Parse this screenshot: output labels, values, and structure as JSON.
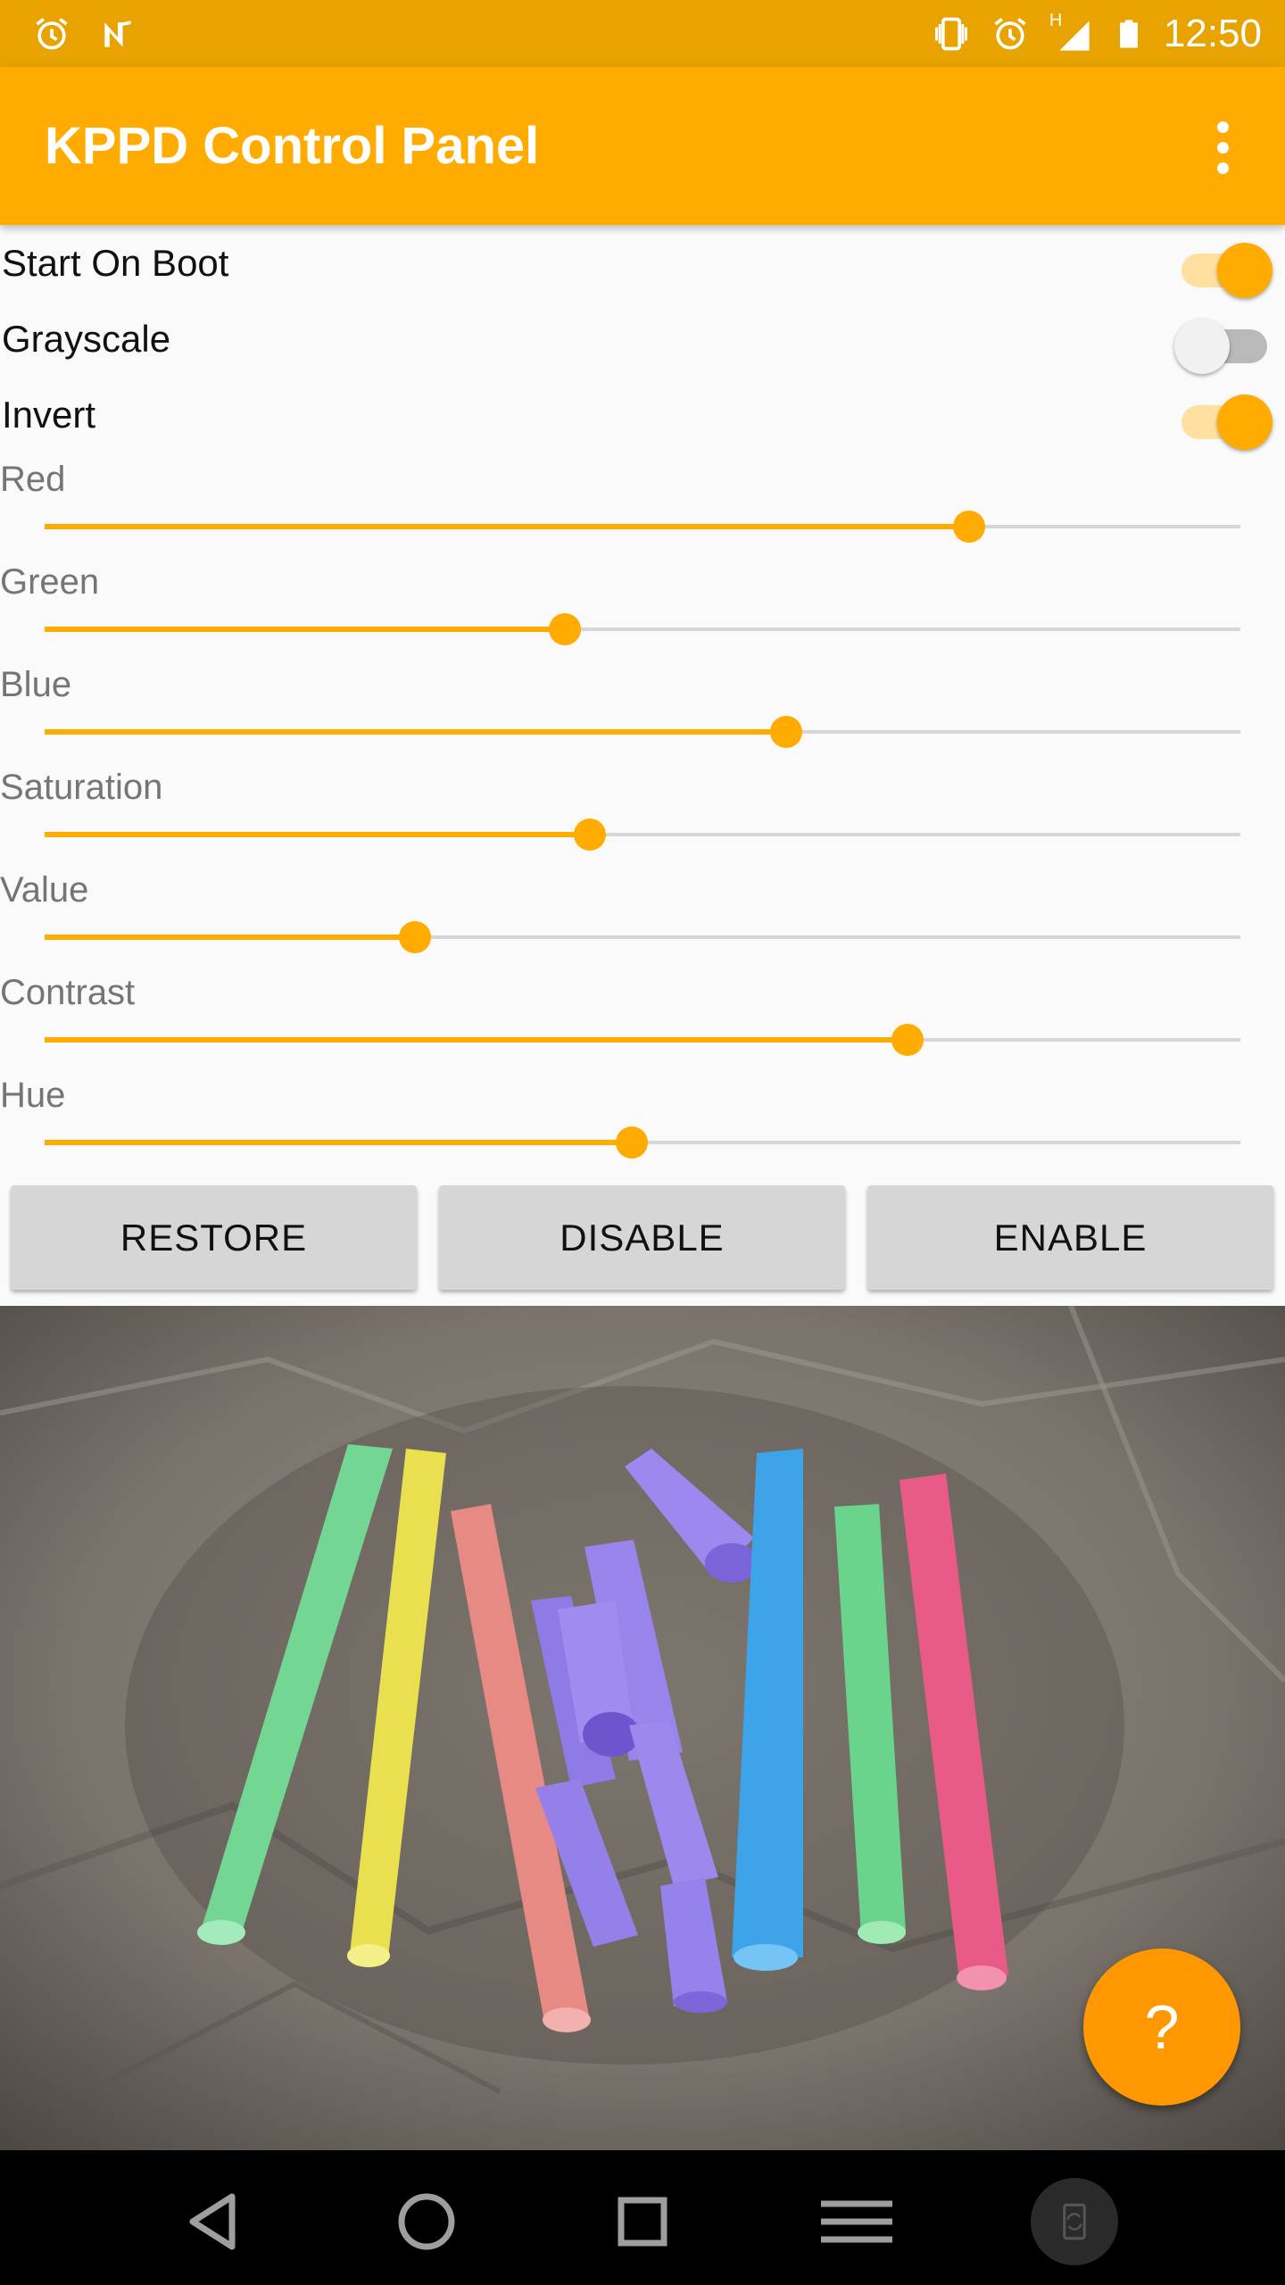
{
  "status_bar": {
    "time": "12:50",
    "network_type": "H",
    "icons_left": [
      "alarm-icon",
      "n-app-icon"
    ],
    "icons_right": [
      "vibrate-icon",
      "alarm-icon",
      "signal-icon",
      "battery-icon"
    ]
  },
  "app_bar": {
    "title": "KPPD Control Panel",
    "menu_icon": "more-vert-icon"
  },
  "switches": [
    {
      "label": "Start On Boot",
      "on": true
    },
    {
      "label": "Grayscale",
      "on": false
    },
    {
      "label": "Invert",
      "on": true
    }
  ],
  "sliders": [
    {
      "label": "Red",
      "value": 0.773
    },
    {
      "label": "Green",
      "value": 0.435
    },
    {
      "label": "Blue",
      "value": 0.62
    },
    {
      "label": "Saturation",
      "value": 0.456
    },
    {
      "label": "Value",
      "value": 0.31
    },
    {
      "label": "Contrast",
      "value": 0.722
    },
    {
      "label": "Hue",
      "value": 0.491
    }
  ],
  "buttons": {
    "restore": "RESTORE",
    "disable": "DISABLE",
    "enable": "ENABLE"
  },
  "fab": {
    "label": "?",
    "icon": "help-icon"
  },
  "colors": {
    "accent": "#ffab00",
    "status_bar": "#e8a300",
    "fab": "#ff9800"
  },
  "nav_bar": {
    "buttons": [
      "back-icon",
      "home-icon",
      "recents-icon",
      "menu-icon",
      "rotate-icon"
    ]
  }
}
